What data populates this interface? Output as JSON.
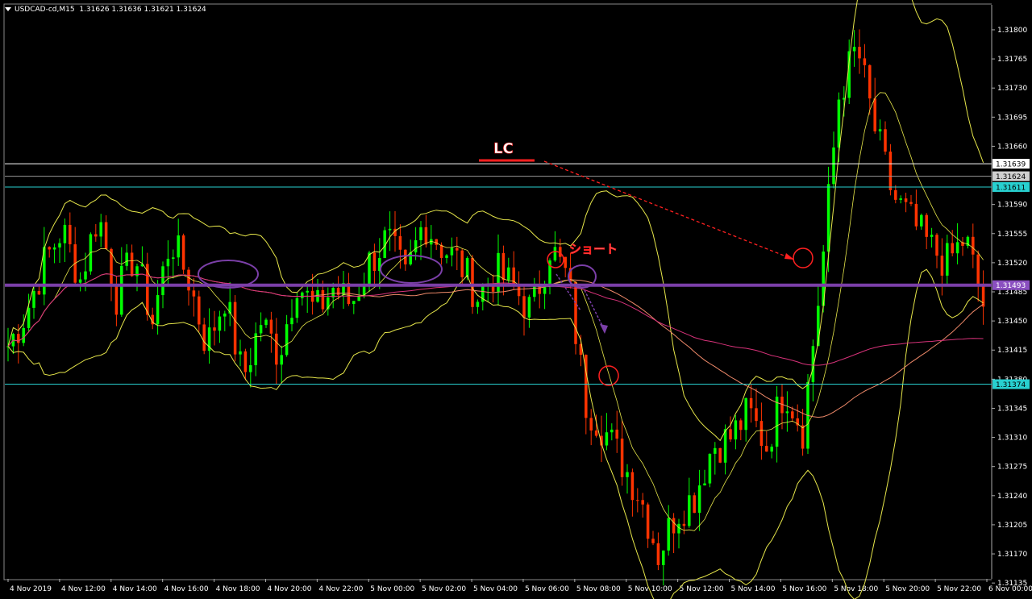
{
  "header": {
    "symbol": "USDCAD-cd,M15",
    "ohlc": "1.31626 1.31636 1.31621 1.31624"
  },
  "colors": {
    "background": "#000000",
    "bull": "#00ff00",
    "bear": "#ff3300",
    "bollinger": "#e6e64a",
    "ma_orange": "#f08a6a",
    "ma_magenta": "#d8327a",
    "horizontal_purple": "#7b3fa8",
    "hline_white": "#ffffff",
    "hline_cyan": "#28d0d0",
    "annotation_red": "#ff2020"
  },
  "chart_data": {
    "type": "candlestick",
    "ylim": [
      1.3114,
      1.3183
    ],
    "y_ticks": [
      "1.31800",
      "1.31765",
      "1.31730",
      "1.31695",
      "1.31660",
      "1.31590",
      "1.31555",
      "1.31520",
      "1.31485",
      "1.31450",
      "1.31415",
      "1.31380",
      "1.31345",
      "1.31310",
      "1.31275",
      "1.31240",
      "1.31205",
      "1.31170",
      "1.31135"
    ],
    "x_ticks": [
      "4 Nov 2019",
      "4 Nov 12:00",
      "4 Nov 14:00",
      "4 Nov 16:00",
      "4 Nov 18:00",
      "4 Nov 20:00",
      "4 Nov 22:00",
      "5 Nov 00:00",
      "5 Nov 02:00",
      "5 Nov 04:00",
      "5 Nov 06:00",
      "5 Nov 08:00",
      "5 Nov 10:00",
      "5 Nov 12:00",
      "5 Nov 14:00",
      "5 Nov 16:00",
      "5 Nov 18:00",
      "5 Nov 20:00",
      "5 Nov 22:00",
      "6 Nov 00:00"
    ],
    "price_labels": [
      {
        "value": 1.31639,
        "text": "1.31639",
        "style": "white"
      },
      {
        "value": 1.31624,
        "text": "1.31624",
        "style": "gray"
      },
      {
        "value": 1.31611,
        "text": "1.31611",
        "style": "cyan"
      },
      {
        "value": 1.31493,
        "text": "1.31493",
        "style": "purple"
      },
      {
        "value": 1.31374,
        "text": "1.31374",
        "style": "cyan"
      }
    ],
    "horizontal_lines": [
      {
        "value": 1.31639,
        "color": "#ffffff"
      },
      {
        "value": 1.31624,
        "color": "#9a9a9a"
      },
      {
        "value": 1.31611,
        "color": "#28d0d0"
      },
      {
        "value": 1.31493,
        "color": "#7b3fa8",
        "thick": true
      },
      {
        "value": 1.31374,
        "color": "#28d0d0"
      }
    ],
    "annotations": {
      "lc_label": "LC",
      "short_label": "ショート"
    },
    "ohlc_anchor_closes": [
      1.3142,
      1.3146,
      1.3152,
      1.3156,
      1.315,
      1.3158,
      1.3148,
      1.3153,
      1.3145,
      1.3155,
      1.315,
      1.3142,
      1.3148,
      1.3138,
      1.3145,
      1.3141,
      1.315,
      1.3146,
      1.3149,
      1.3147,
      1.3152,
      1.3155,
      1.315,
      1.3157,
      1.3154,
      1.3152,
      1.3148,
      1.3151,
      1.3149,
      1.3146,
      1.3154,
      1.315,
      1.3135,
      1.3132,
      1.3128,
      1.3124,
      1.3117,
      1.3122,
      1.3124,
      1.313,
      1.3131,
      1.3134,
      1.313,
      1.3137,
      1.3132,
      1.315,
      1.3172,
      1.3178,
      1.3168,
      1.316,
      1.3157,
      1.3154,
      1.3152,
      1.3155,
      1.3147
    ]
  }
}
